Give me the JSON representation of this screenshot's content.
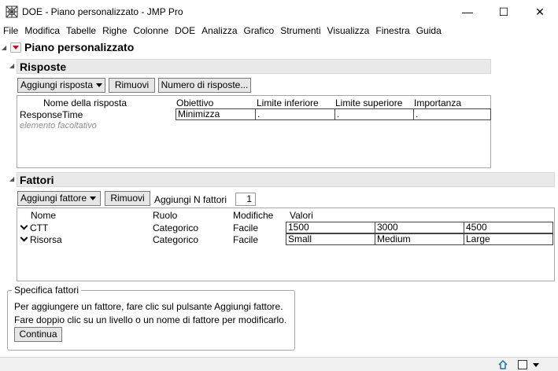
{
  "window": {
    "title": "DOE - Piano personalizzato - JMP Pro",
    "minimize_glyph": "—",
    "maximize_glyph": "☐",
    "close_glyph": "✕"
  },
  "menubar": [
    "File",
    "Modifica",
    "Tabelle",
    "Righe",
    "Colonne",
    "DOE",
    "Analizza",
    "Grafico",
    "Strumenti",
    "Visualizza",
    "Finestra",
    "Guida"
  ],
  "main": {
    "title": "Piano personalizzato"
  },
  "risposte": {
    "header": "Risposte",
    "buttons": {
      "add": "Aggiungi risposta",
      "remove": "Rimuovi",
      "count": "Numero di risposte..."
    },
    "columns": [
      "Nome della risposta",
      "Obiettivo",
      "Limite inferiore",
      "Limite superiore",
      "Importanza"
    ],
    "rows": [
      {
        "name": "ResponseTime",
        "goal": "Minimizza",
        "lower": ".",
        "upper": ".",
        "importance": "."
      }
    ],
    "optional_hint": "elemento facoltativo"
  },
  "fattori": {
    "header": "Fattori",
    "buttons": {
      "add": "Aggiungi fattore",
      "remove": "Rimuovi"
    },
    "add_n_label": "Aggiungi N fattori",
    "add_n_value": "1",
    "columns": [
      "Nome",
      "Ruolo",
      "Modifiche",
      "Valori"
    ],
    "rows": [
      {
        "name": "CTT",
        "role": "Categorico",
        "changes": "Facile",
        "values": [
          "1500",
          "3000",
          "4500"
        ]
      },
      {
        "name": "Risorsa",
        "role": "Categorico",
        "changes": "Facile",
        "values": [
          "Small",
          "Medium",
          "Large"
        ]
      }
    ]
  },
  "specifica": {
    "legend": "Specifica fattori",
    "line1": "Per aggiungere un fattore, fare clic sul pulsante Aggiungi fattore.",
    "line2": "Fare doppio clic su un livello o un nome di fattore per modificarlo.",
    "continue": "Continua"
  },
  "statusbar": {
    "icons": [
      "home-icon",
      "window-icon",
      "dropdown-icon"
    ]
  }
}
